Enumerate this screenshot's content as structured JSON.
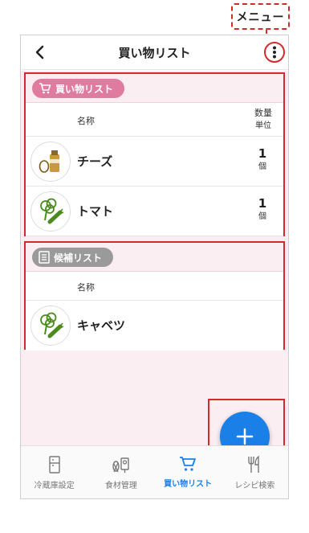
{
  "callout": {
    "label": "メニュー"
  },
  "header": {
    "title": "買い物リスト"
  },
  "shopping_list": {
    "badge": "買い物リスト",
    "col_name": "名称",
    "col_qty": "数量",
    "col_unit": "単位",
    "items": [
      {
        "name": "チーズ",
        "qty": "1",
        "unit": "個",
        "icon": "cheese-milk-icon"
      },
      {
        "name": "トマト",
        "qty": "1",
        "unit": "個",
        "icon": "vegetables-icon"
      }
    ]
  },
  "candidate_list": {
    "badge": "候補リスト",
    "col_name": "名称",
    "items": [
      {
        "name": "キャベツ",
        "icon": "vegetables-icon"
      }
    ]
  },
  "tabs": [
    {
      "label": "冷蔵庫設定",
      "icon": "fridge-icon",
      "active": false
    },
    {
      "label": "食材管理",
      "icon": "ingredients-icon",
      "active": false
    },
    {
      "label": "買い物リスト",
      "icon": "cart-icon",
      "active": true
    },
    {
      "label": "レシピ検索",
      "icon": "fork-knife-icon",
      "active": false
    }
  ],
  "colors": {
    "accent": "#1a7fe6",
    "highlight": "#d32b2b",
    "pink_badge": "#e07ba0",
    "gray_badge": "#9a9a9a",
    "list_background": "#fbeef2"
  }
}
